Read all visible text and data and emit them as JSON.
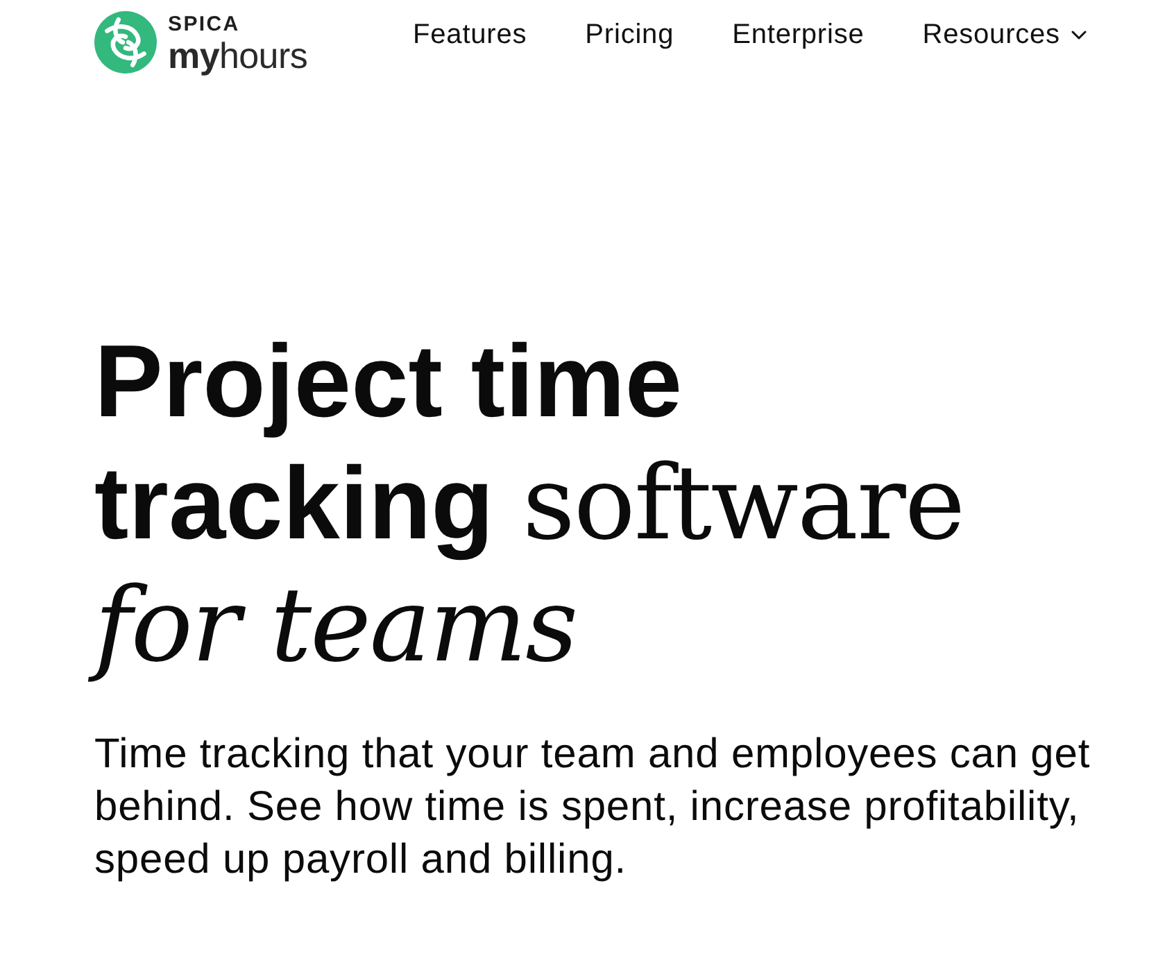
{
  "header": {
    "logo": {
      "small_text": "SPICA",
      "text": "**my**hours"
    },
    "nav": [
      {
        "label": "Features",
        "kind": "link"
      },
      {
        "label": "Pricing",
        "kind": "link"
      },
      {
        "label": "Enterprise",
        "kind": "link"
      },
      {
        "label": "Resources",
        "kind": "dropdown"
      }
    ]
  },
  "hero": {
    "heading": [
      {
        "text": "Project time tracking",
        "kind": "sans-bold"
      },
      {
        "text": "software",
        "kind": "serif"
      },
      {
        "text": "for teams",
        "kind": "serif-italic"
      }
    ],
    "description": "Time tracking that your team and employees can get behind. See how time is spent, increase profitability, speed up payroll and billing."
  }
}
